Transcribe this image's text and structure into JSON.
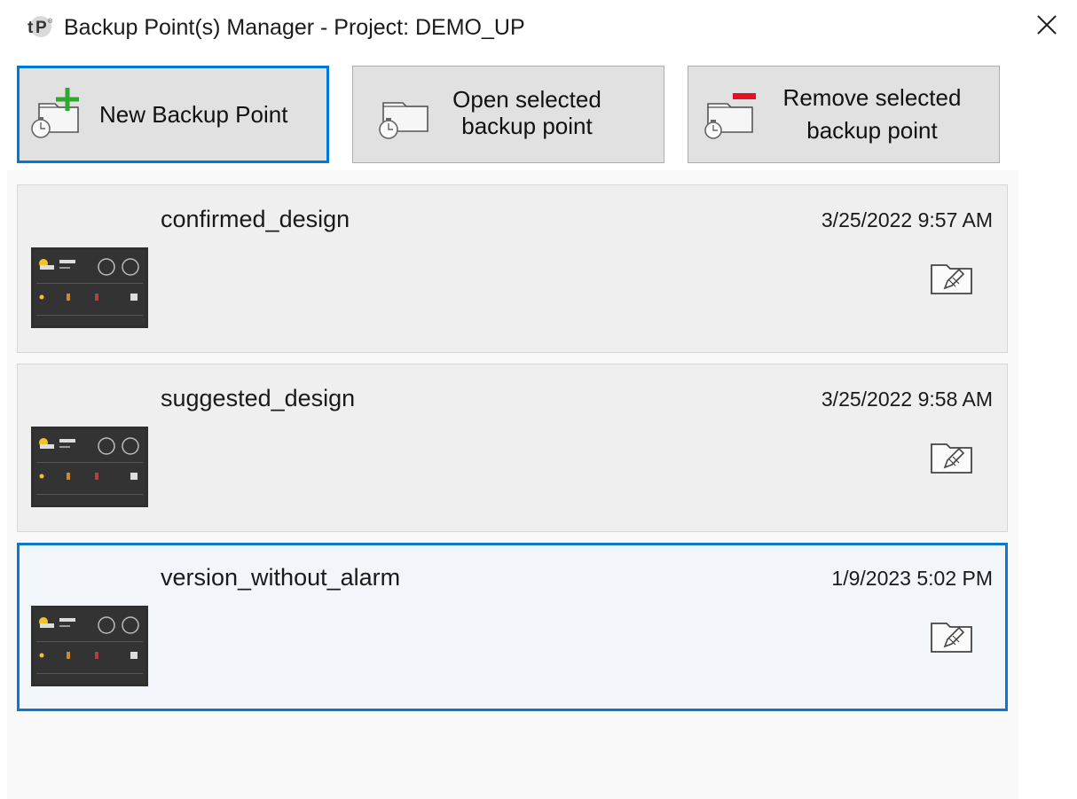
{
  "window": {
    "title": "Backup Point(s) Manager - Project: DEMO_UP",
    "logo_icon": "tp-logo-icon",
    "close_icon": "close-icon"
  },
  "toolbar": {
    "new_label": "New Backup Point",
    "open_label_line1": "Open selected",
    "open_label_line2": "backup point",
    "remove_label_line1": "Remove selected",
    "remove_label_line2": "backup point",
    "new_icon": "new-backup-point-icon",
    "open_icon": "open-backup-point-icon",
    "remove_icon": "remove-backup-point-icon"
  },
  "backup_points": [
    {
      "name": "confirmed_design",
      "date": "3/25/2022 9:57 AM",
      "selected": false
    },
    {
      "name": "suggested_design",
      "date": "3/25/2022 9:58 AM",
      "selected": false
    },
    {
      "name": "version_without_alarm",
      "date": "1/9/2023 5:02 PM",
      "selected": true
    }
  ],
  "colors": {
    "accent": "#0078d7",
    "plus_green": "#2fa82f",
    "minus_red": "#e81123",
    "button_bg": "#e1e1e1",
    "thumb_bg": "#2f2f2f"
  }
}
